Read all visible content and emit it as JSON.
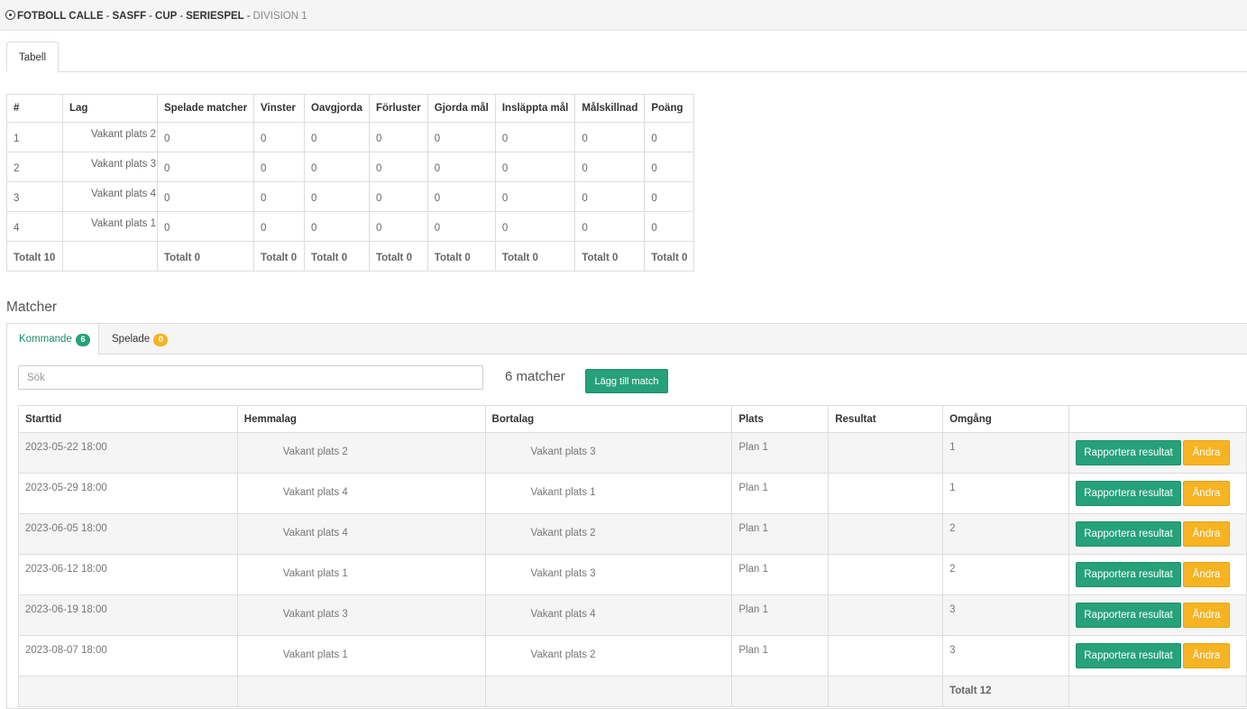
{
  "breadcrumb": {
    "icon": "soccer-ball-icon",
    "items": [
      "FOTBOLL CALLE",
      "SASFF",
      "CUP",
      "SERIESPEL"
    ],
    "separator": "-",
    "current": "DIVISION 1"
  },
  "top_tabs": {
    "tabell": "Tabell"
  },
  "standings": {
    "headers": [
      "#",
      "Lag",
      "Spelade matcher",
      "Vinster",
      "Oavgjorda",
      "Förluster",
      "Gjorda mål",
      "Insläppta mål",
      "Målskillnad",
      "Poäng"
    ],
    "rows": [
      [
        "1",
        "Vakant plats 2",
        "0",
        "0",
        "0",
        "0",
        "0",
        "0",
        "0",
        "0"
      ],
      [
        "2",
        "Vakant plats 3",
        "0",
        "0",
        "0",
        "0",
        "0",
        "0",
        "0",
        "0"
      ],
      [
        "3",
        "Vakant plats 4",
        "0",
        "0",
        "0",
        "0",
        "0",
        "0",
        "0",
        "0"
      ],
      [
        "4",
        "Vakant plats 1",
        "0",
        "0",
        "0",
        "0",
        "0",
        "0",
        "0",
        "0"
      ]
    ],
    "totals": [
      "Totalt 10",
      "",
      "Totalt 0",
      "Totalt 0",
      "Totalt 0",
      "Totalt 0",
      "Totalt 0",
      "Totalt 0",
      "Totalt 0",
      "Totalt 0"
    ]
  },
  "matches_section": {
    "title": "Matcher",
    "tabs": {
      "upcoming_label": "Kommande",
      "upcoming_count": "6",
      "played_label": "Spelade",
      "played_count": "0"
    },
    "search_placeholder": "Sök",
    "count_text": "6 matcher",
    "add_button": "Lägg till match",
    "headers": [
      "Starttid",
      "Hemmalag",
      "Bortalag",
      "Plats",
      "Resultat",
      "Omgång",
      ""
    ],
    "rows": [
      {
        "start": "2023-05-22 18:00",
        "home": "Vakant plats 2",
        "away": "Vakant plats 3",
        "venue": "Plan 1",
        "result": "",
        "round": "1"
      },
      {
        "start": "2023-05-29 18:00",
        "home": "Vakant plats 4",
        "away": "Vakant plats 1",
        "venue": "Plan 1",
        "result": "",
        "round": "1"
      },
      {
        "start": "2023-06-05 18:00",
        "home": "Vakant plats 4",
        "away": "Vakant plats 2",
        "venue": "Plan 1",
        "result": "",
        "round": "2"
      },
      {
        "start": "2023-06-12 18:00",
        "home": "Vakant plats 1",
        "away": "Vakant plats 3",
        "venue": "Plan 1",
        "result": "",
        "round": "2"
      },
      {
        "start": "2023-06-19 18:00",
        "home": "Vakant plats 3",
        "away": "Vakant plats 4",
        "venue": "Plan 1",
        "result": "",
        "round": "3"
      },
      {
        "start": "2023-08-07 18:00",
        "home": "Vakant plats 1",
        "away": "Vakant plats 2",
        "venue": "Plan 1",
        "result": "",
        "round": "3"
      }
    ],
    "report_button": "Rapportera resultat",
    "edit_button": "Ändra",
    "total_rounds": "Totalt 12"
  },
  "colors": {
    "primary": "#26a17a",
    "warning": "#f6b322",
    "active_tab_text": "#1a8e6d"
  }
}
